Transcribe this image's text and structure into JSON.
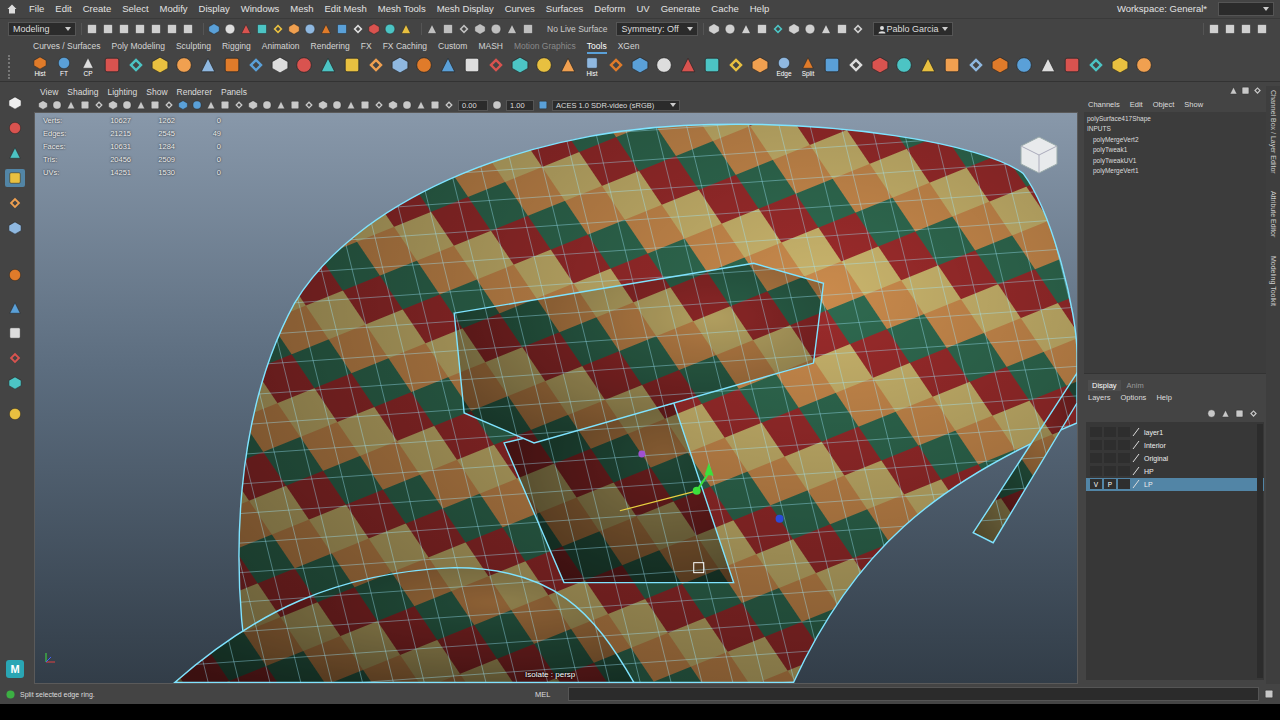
{
  "menu_bar": {
    "items": [
      "File",
      "Edit",
      "Create",
      "Select",
      "Modify",
      "Display",
      "Windows",
      "Mesh",
      "Edit Mesh",
      "Mesh Tools",
      "Mesh Display",
      "Curves",
      "Surfaces",
      "Deform",
      "UV",
      "Generate",
      "Cache",
      "Help"
    ],
    "workspace": "Workspace: General*"
  },
  "status_line": {
    "mode": "Modeling",
    "live_surface": "No Live Surface",
    "symmetry": "Symmetry: Off",
    "user": "Pablo Garcia"
  },
  "shelf": {
    "tabs": [
      {
        "label": "Curves / Surfaces",
        "selected": false,
        "dimmed": false
      },
      {
        "label": "Poly Modeling",
        "selected": false,
        "dimmed": false
      },
      {
        "label": "Sculpting",
        "selected": false,
        "dimmed": false
      },
      {
        "label": "Rigging",
        "selected": false,
        "dimmed": false
      },
      {
        "label": "Animation",
        "selected": false,
        "dimmed": false
      },
      {
        "label": "Rendering",
        "selected": false,
        "dimmed": false
      },
      {
        "label": "FX",
        "selected": false,
        "dimmed": false
      },
      {
        "label": "FX Caching",
        "selected": false,
        "dimmed": false
      },
      {
        "label": "Custom",
        "selected": false,
        "dimmed": false
      },
      {
        "label": "MASH",
        "selected": false,
        "dimmed": false
      },
      {
        "label": "Motion Graphics",
        "selected": false,
        "dimmed": true
      },
      {
        "label": "Tools",
        "selected": true,
        "dimmed": false
      },
      {
        "label": "XGen",
        "selected": false,
        "dimmed": false
      }
    ],
    "icon_labels": [
      "Hist",
      "FT",
      "CP",
      "Hist",
      "Edge",
      "Split"
    ]
  },
  "toolbox": {
    "tools": [
      {
        "selected": false
      },
      {
        "selected": false
      },
      {
        "selected": false
      },
      {
        "selected": true
      },
      {
        "selected": false
      },
      {
        "selected": false
      },
      {
        "selected": false
      },
      {
        "selected": false
      },
      {
        "selected": false
      },
      {
        "selected": false
      },
      {
        "selected": false
      },
      {
        "selected": false
      }
    ],
    "logo_badge": "M"
  },
  "viewport": {
    "menu": [
      "View",
      "Shading",
      "Lighting",
      "Show",
      "Renderer",
      "Panels"
    ],
    "exposure": "0.00",
    "gamma": "1.00",
    "color_space": "ACES 1.0 SDR-video (sRGB)",
    "hud": [
      {
        "label": "Verts:",
        "values": [
          "10627",
          "1262",
          "0"
        ]
      },
      {
        "label": "Edges:",
        "values": [
          "21215",
          "2545",
          "49"
        ]
      },
      {
        "label": "Faces:",
        "values": [
          "10631",
          "1284",
          "0"
        ]
      },
      {
        "label": "Tris:",
        "values": [
          "20456",
          "2509",
          "0"
        ]
      },
      {
        "label": "UVs:",
        "values": [
          "14251",
          "1530",
          "0"
        ]
      }
    ],
    "camera_label": "Isolate : persp"
  },
  "channel_box": {
    "menu": [
      "Channels",
      "Edit",
      "Object",
      "Show"
    ],
    "object": "polySurface417Shape",
    "section": "INPUTS",
    "inputs": [
      "polyMergeVert2",
      "polyTweak1",
      "polyTweakUV1",
      "polyMergeVert1"
    ]
  },
  "layer_editor": {
    "tabs": [
      {
        "label": "Display",
        "selected": true
      },
      {
        "label": "Anim",
        "selected": false
      }
    ],
    "menu": [
      "Layers",
      "Options",
      "Help"
    ],
    "flag_labels": [
      "V",
      "P"
    ],
    "layers": [
      {
        "name": "layer1",
        "flags_shown": false,
        "selected": false
      },
      {
        "name": "Interior",
        "flags_shown": false,
        "selected": false
      },
      {
        "name": "Original",
        "flags_shown": false,
        "selected": false
      },
      {
        "name": "HP",
        "flags_shown": false,
        "selected": false
      },
      {
        "name": "LP",
        "flags_shown": true,
        "selected": true
      }
    ]
  },
  "side_tabs": [
    "Channel Box / Layer Editor",
    "Attribute Editor",
    "Modeling Toolkit"
  ],
  "command_line": {
    "language": "MEL"
  },
  "help_line": "Split selected edge ring."
}
